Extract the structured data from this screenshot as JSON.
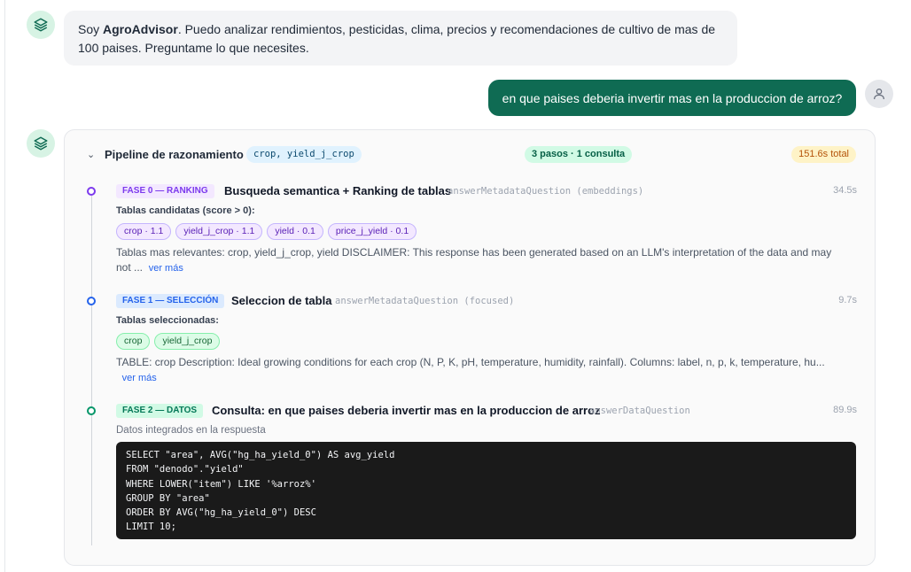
{
  "assistant_intro": {
    "prefix": "Soy ",
    "name": "AgroAdvisor",
    "line1_rest": ". Puedo analizar rendimientos, pesticidas, clima, precios y recomendaciones de cultivo de mas de",
    "line2": "100 paises. Preguntame lo que necesites."
  },
  "user_message": "en que paises deberia invertir mas en la produccion de arroz?",
  "pipeline": {
    "title": "Pipeline de razonamiento",
    "tables_badge": "crop, yield_j_crop",
    "steps_badge": "3 pasos · 1 consulta",
    "total_badge": "151.6s total",
    "phases": [
      {
        "tag": "FASE 0 — RANKING",
        "title": "Busqueda semantica + Ranking de tablas",
        "fn": "answerMetadataQuestion (embeddings)",
        "time": "34.5s",
        "sub_label": "Tablas candidatas (score > 0):",
        "chips": [
          "crop · 1.1",
          "yield_j_crop · 1.1",
          "yield · 0.1",
          "price_j_yield · 0.1"
        ],
        "desc_line1": "Tablas mas relevantes: crop, yield_j_crop, yield DISCLAIMER: This response has been generated based on an LLM's interpretation of the data and may",
        "desc_line2": "not ...",
        "more": "ver más",
        "color": "#7c3aed"
      },
      {
        "tag": "FASE 1 — SELECCIÓN",
        "title": "Seleccion de tabla",
        "fn": "answerMetadataQuestion (focused)",
        "time": "9.7s",
        "sub_label": "Tablas seleccionadas:",
        "chips": [
          "crop",
          "yield_j_crop"
        ],
        "desc_line1": "TABLE: crop Description: Ideal growing conditions for each crop (N, P, K, pH, temperature, humidity, rainfall). Columns: label, n, p, k, temperature, hu...",
        "more": "ver más",
        "color": "#2563eb"
      },
      {
        "tag": "FASE 2 — DATOS",
        "title": "Consulta: en que paises deberia invertir mas en la produccion de arroz",
        "fn": "answerDataQuestion",
        "time": "89.9s",
        "sub_label": "Datos integrados en la respuesta",
        "color": "#059669"
      }
    ],
    "sql_lines": [
      "SELECT \"area\", AVG(\"hg_ha_yield_0\") AS avg_yield",
      "FROM \"denodo\".\"yield\"",
      "WHERE LOWER(\"item\") LIKE '%arroz%'",
      "GROUP BY \"area\"",
      "ORDER BY AVG(\"hg_ha_yield_0\") DESC",
      "LIMIT 10;"
    ]
  },
  "icons": {
    "assistant_avatar": "layers-icon",
    "user_avatar": "user-icon",
    "collapse": "chevron-down-icon"
  }
}
